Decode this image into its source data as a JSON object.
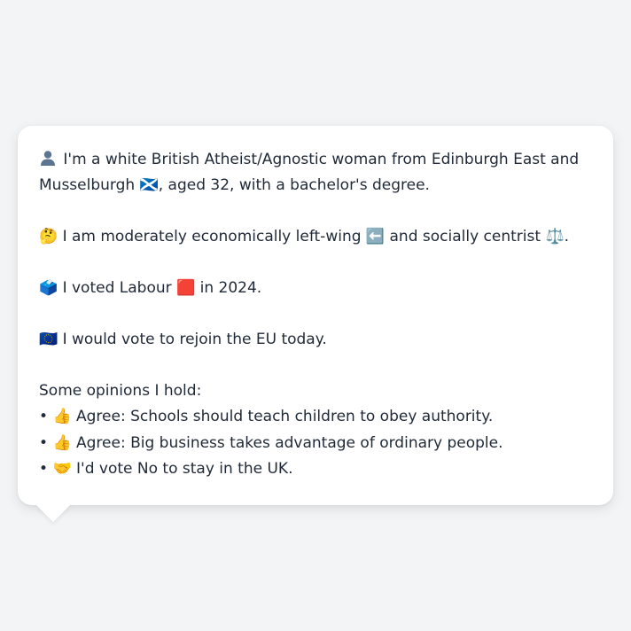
{
  "profile": {
    "identity": {
      "icon": "person-silhouette-icon",
      "text_a": "I'm a white British Atheist/Agnostic woman from Edinburgh East and Musselburgh",
      "flag": "🏴󠁧󠁢󠁳󠁣󠁴󠁿",
      "text_b": ", aged 32, with a bachelor's degree."
    },
    "politics": {
      "emoji": "🤔",
      "text_a": "I am moderately economically left-wing",
      "arrow": "⬅️",
      "text_b": "and socially centrist",
      "scale": "⚖️",
      "text_c": "."
    },
    "vote": {
      "emoji": "🗳️",
      "text_a": "I voted Labour",
      "square": "🟥",
      "text_b": "in 2024."
    },
    "eu": {
      "emoji": "🇪🇺",
      "text": "I would vote to rejoin the EU today."
    },
    "opinions": {
      "heading": "Some opinions I hold:",
      "items": [
        {
          "bullet": "•",
          "emoji": "👍",
          "text": "Agree: Schools should teach children to obey authority."
        },
        {
          "bullet": "•",
          "emoji": "👍",
          "text": "Agree: Big business takes advantage of ordinary people."
        },
        {
          "bullet": "•",
          "emoji": "🤝",
          "text": "I'd vote No to stay in the UK."
        }
      ]
    }
  },
  "colors": {
    "background": "#f3f4f6",
    "card": "#ffffff",
    "text": "#1f2937"
  }
}
